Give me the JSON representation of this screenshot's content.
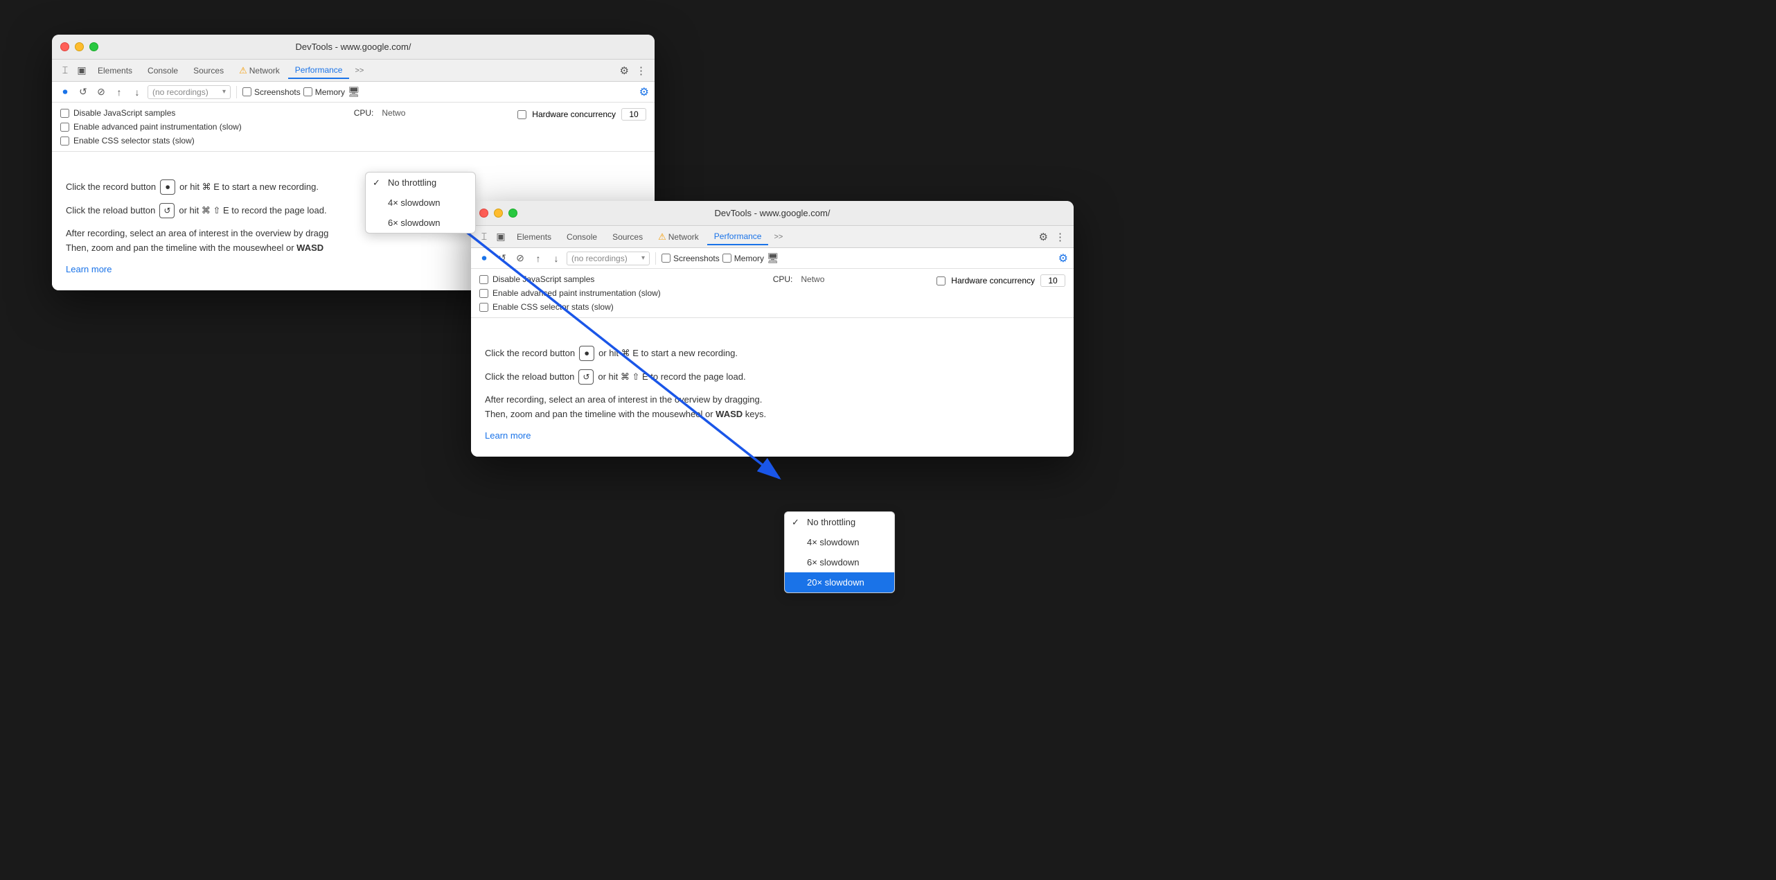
{
  "title": "DevTools - www.google.com/",
  "tabs": {
    "icons": [
      "cursor-icon",
      "layers-icon"
    ],
    "items": [
      {
        "label": "Elements",
        "active": false
      },
      {
        "label": "Console",
        "active": false
      },
      {
        "label": "Sources",
        "active": false
      },
      {
        "label": "Network",
        "active": false,
        "warning": true
      },
      {
        "label": "Performance",
        "active": true
      },
      {
        "label": ">>",
        "active": false
      }
    ],
    "gear_label": "⚙",
    "more_label": "⋮"
  },
  "toolbar": {
    "record_label": "⏺",
    "reload_label": "↺",
    "clear_label": "⊘",
    "upload_label": "↑",
    "download_label": "↓",
    "recordings_placeholder": "(no recordings)",
    "screenshots_label": "Screenshots",
    "memory_label": "Memory",
    "cpu_icon": "🖥"
  },
  "settings": {
    "disable_js_label": "Disable JavaScript samples",
    "advanced_paint_label": "Enable advanced paint instrumentation (slow)",
    "css_selector_label": "Enable CSS selector stats (slow)",
    "hardware_concurrency_label": "Hardware concurrency",
    "hardware_concurrency_value": "10",
    "cpu_label": "CPU:",
    "network_label": "Netwo",
    "throttle_options": [
      {
        "label": "No throttling",
        "checked": true,
        "selected": false
      },
      {
        "label": "4× slowdown",
        "checked": false,
        "selected": false
      },
      {
        "label": "6× slowdown",
        "checked": false,
        "selected": false
      }
    ]
  },
  "instructions": {
    "record_text1": "Click the record button",
    "record_text2": "or hit ⌘ E to start a new recording.",
    "reload_text1": "Click the reload button",
    "reload_text2": "or hit ⌘ ⇧ E to record the page load.",
    "after_text1": "After recording, select an area of interest in the overview by dragging.",
    "after_text2": "Then, zoom and pan the timeline with the mousewheel or ",
    "wasd_text": "WASD",
    "after_text3": " keys.",
    "learn_more": "Learn more"
  },
  "front_window": {
    "throttle_options": [
      {
        "label": "No throttling",
        "checked": true,
        "selected": false
      },
      {
        "label": "4× slowdown",
        "checked": false,
        "selected": false
      },
      {
        "label": "6× slowdown",
        "checked": false,
        "selected": false
      },
      {
        "label": "20× slowdown",
        "checked": false,
        "selected": true
      }
    ]
  }
}
